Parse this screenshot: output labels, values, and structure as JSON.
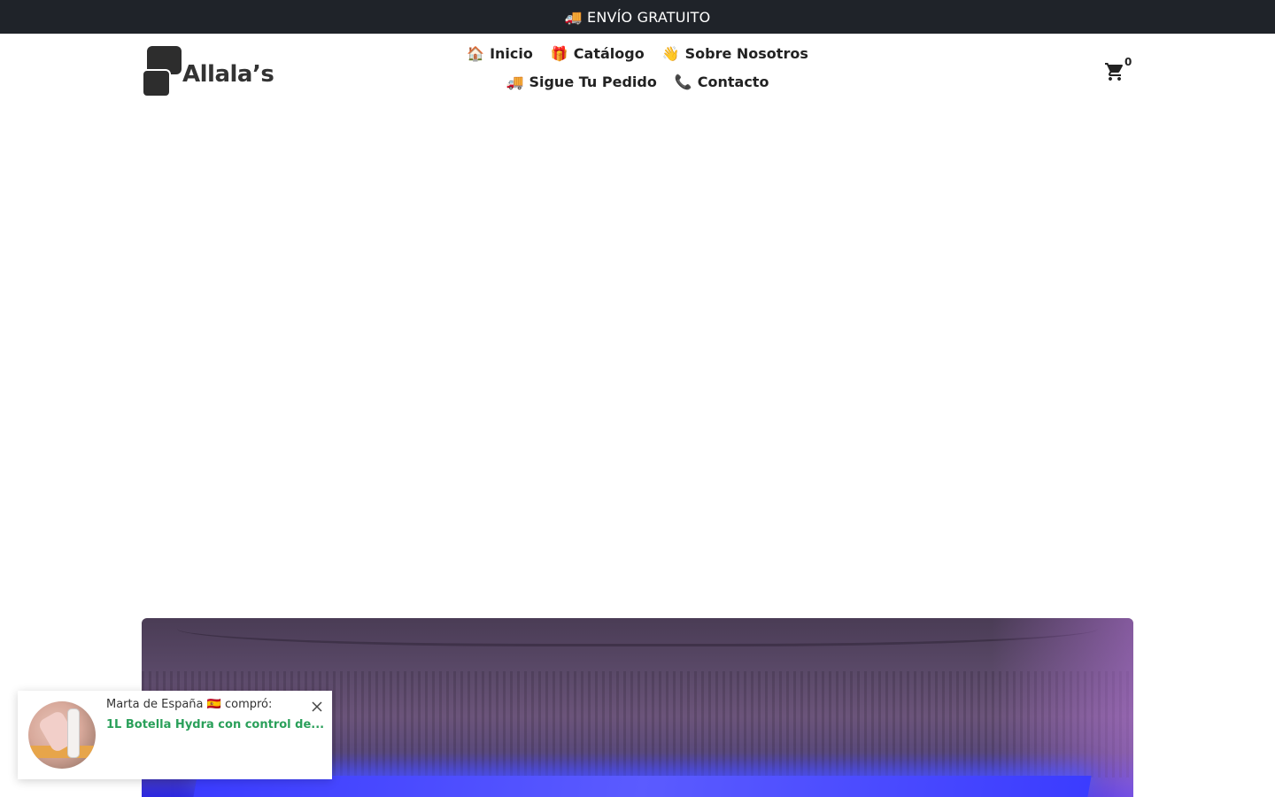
{
  "announcement": {
    "text": "🚚 ENVÍO GRATUITO"
  },
  "header": {
    "logo_text": "Allala’s",
    "nav": [
      {
        "emoji": "🏠",
        "label": "Inicio"
      },
      {
        "emoji": "🎁",
        "label": "Catálogo"
      },
      {
        "emoji": "👋",
        "label": "Sobre Nosotros"
      },
      {
        "emoji": "🚚",
        "label": "Sigue Tu Pedido"
      },
      {
        "emoji": "📞",
        "label": "Contacto"
      }
    ],
    "cart_count": "0",
    "cart_icon": "shopping-cart-icon"
  },
  "popup": {
    "line1": "Marta de España 🇪🇸 compró:",
    "line2": "1L Botella Hydra con control de...",
    "close_icon": "close-icon"
  },
  "colors": {
    "announcement_bg": "#1f2329",
    "text": "#222222",
    "popup_product": "#2aa05a"
  }
}
